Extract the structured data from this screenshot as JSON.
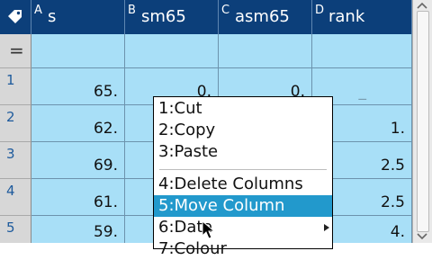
{
  "columns": [
    {
      "letter": "A",
      "name": "s"
    },
    {
      "letter": "B",
      "name": "sm65"
    },
    {
      "letter": "C",
      "name": "asm65"
    },
    {
      "letter": "D",
      "name": "rank"
    }
  ],
  "formula_row_label": "=",
  "rows": [
    {
      "num": "1",
      "s": "65.",
      "sm65": "0.",
      "asm65": "0.",
      "rank": "_"
    },
    {
      "num": "2",
      "s": "62.",
      "sm65": "",
      "asm65": "",
      "rank": "1."
    },
    {
      "num": "3",
      "s": "69.",
      "sm65": "",
      "asm65": "",
      "rank": "2.5"
    },
    {
      "num": "4",
      "s": "61.",
      "sm65": "",
      "asm65": "",
      "rank": "2.5"
    },
    {
      "num": "5",
      "s": "59.",
      "sm65": "",
      "asm65": "",
      "rank": "4."
    }
  ],
  "context_menu": {
    "items": [
      {
        "label": "1:Cut"
      },
      {
        "label": "2:Copy"
      },
      {
        "label": "3:Paste"
      },
      {
        "label": "4:Delete Columns"
      },
      {
        "label": "5:Move Column",
        "selected": true
      },
      {
        "label": "6:Data",
        "submenu": true
      },
      {
        "label": "7:Colour"
      }
    ]
  },
  "colors": {
    "header_bg": "#0c3f7a",
    "cell_bg": "#a8dff7",
    "row_header_bg": "#d7d7d7",
    "menu_highlight": "#2299cc"
  }
}
